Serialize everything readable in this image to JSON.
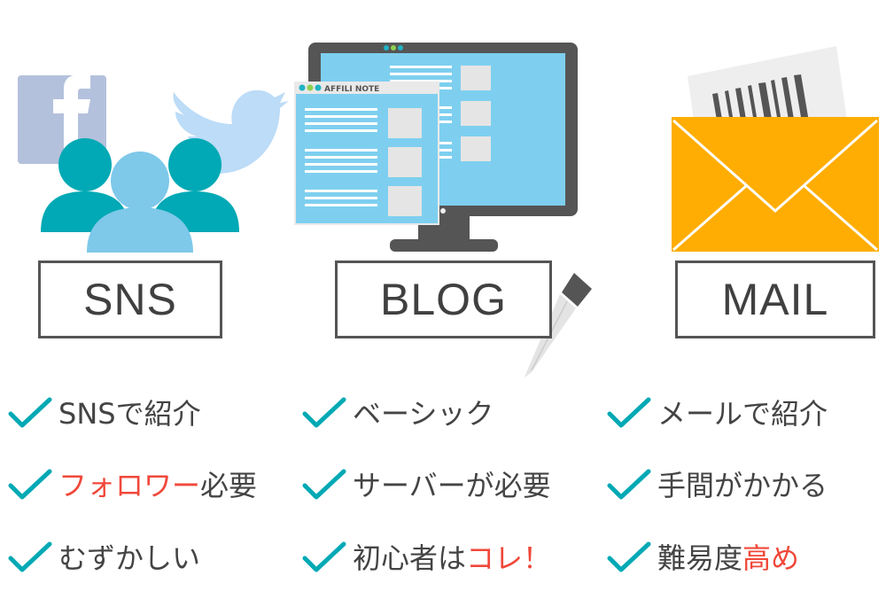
{
  "colors": {
    "teal": "#00a9b5",
    "light_blue": "#7ec8ea",
    "facebook": "#b4c1dc",
    "twitter": "#bcdcf7",
    "monitor": "#555555",
    "screen": "#7ecfef",
    "envelope": "#ffad02",
    "check": "#00a9b5",
    "highlight": "#f0483a",
    "text": "#444444"
  },
  "icons": {
    "sns": [
      "facebook-icon",
      "twitter-icon",
      "users-group-icon"
    ],
    "blog": [
      "monitor-icon",
      "browser-window-icon",
      "fountain-pen-icon"
    ],
    "mail": [
      "envelope-icon",
      "letter-icon"
    ]
  },
  "illustration": {
    "browser_title": "AFFILI NOTE"
  },
  "columns": [
    {
      "label": "SNS",
      "items": [
        {
          "pre": "SNSで紹介",
          "hl": "",
          "post": ""
        },
        {
          "pre": "",
          "hl": "フォロワー",
          "post": "必要"
        },
        {
          "pre": "むずかしい",
          "hl": "",
          "post": ""
        }
      ]
    },
    {
      "label": "BLOG",
      "items": [
        {
          "pre": "ベーシック",
          "hl": "",
          "post": ""
        },
        {
          "pre": "サーバーが必要",
          "hl": "",
          "post": ""
        },
        {
          "pre": "初心者は",
          "hl": "コレ！",
          "post": ""
        }
      ]
    },
    {
      "label": "MAIL",
      "items": [
        {
          "pre": "メールで紹介",
          "hl": "",
          "post": ""
        },
        {
          "pre": "手間がかかる",
          "hl": "",
          "post": ""
        },
        {
          "pre": "難易度",
          "hl": "高め",
          "post": ""
        }
      ]
    }
  ]
}
